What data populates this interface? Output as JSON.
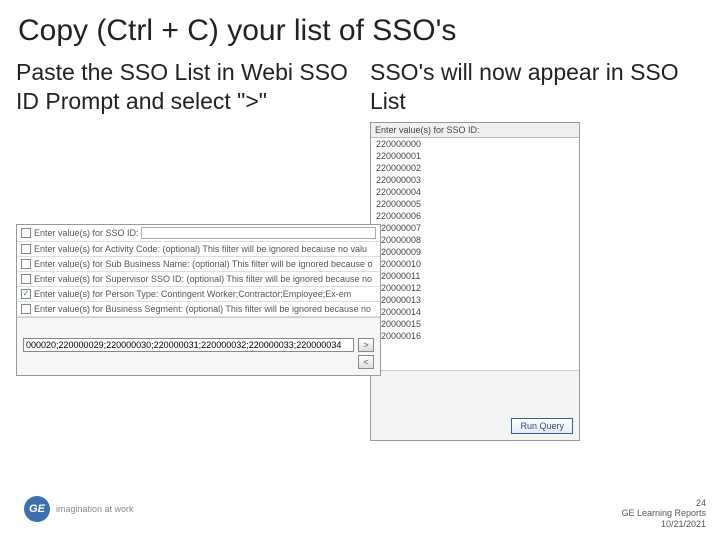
{
  "slide": {
    "title": "Copy (Ctrl + C) your list of SSO's",
    "left_heading": "Paste the SSO List in Webi SSO ID Prompt and select \">\"",
    "right_heading": "SSO's will now appear in SSO List"
  },
  "left_panel": {
    "rows": [
      {
        "label": "Enter value(s) for SSO ID:",
        "checked": false,
        "input": true,
        "tail": ""
      },
      {
        "label": "Enter value(s) for Activity Code: (optional) This filter will be ignored because no valu",
        "checked": false,
        "tail": ""
      },
      {
        "label": "Enter value(s) for Sub Business Name: (optional) This filter will be ignored because o",
        "checked": false,
        "tail": ""
      },
      {
        "label": "Enter value(s) for Supervisor SSO ID: (optional) This filter will be ignored because no",
        "checked": false,
        "tail": ""
      },
      {
        "label": "Enter value(s) for Person Type: Contingent Worker;Contractor;Employee;Ex-em",
        "checked": true,
        "tail": ""
      },
      {
        "label": "Enter value(s) for Business Segment: (optional) This filter will be ignored because no",
        "checked": false,
        "tail": ""
      }
    ],
    "paste_value": "000020;220000029;220000030;220000031;220000032;220000033;220000034",
    "move_right": ">",
    "move_left": "<"
  },
  "right_panel": {
    "header": "Enter value(s) for SSO ID:",
    "values": [
      "220000000",
      "220000001",
      "220000002",
      "220000003",
      "220000004",
      "220000005",
      "220000006",
      "220000007",
      "220000008",
      "220000009",
      "220000010",
      "220000011",
      "220000012",
      "220000013",
      "220000014",
      "220000015",
      "220000016"
    ],
    "run_label": "Run Query"
  },
  "footer": {
    "logo_text": "GE",
    "tagline": "imagination at work",
    "page": "24",
    "source": "GE Learning Reports",
    "date": "10/21/2021"
  }
}
